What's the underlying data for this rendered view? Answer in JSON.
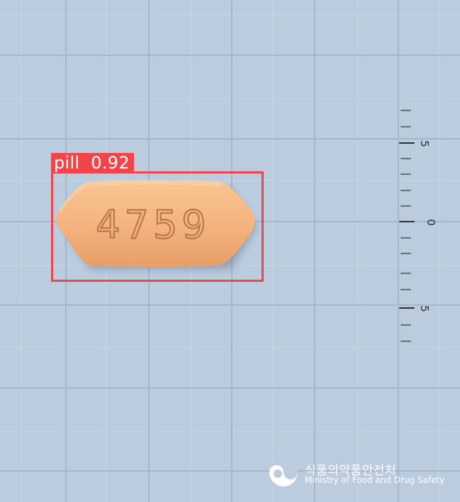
{
  "detection": {
    "label": "pill  0.92",
    "color": "#f2454a"
  },
  "pill": {
    "imprint": "4759",
    "color": "#f4b27e"
  },
  "ruler": {
    "labels": [
      "5",
      "0",
      "5"
    ]
  },
  "watermark": {
    "korean": "식품의약품안전처",
    "english": "Ministry of Food and Drug Safety",
    "logo_icon": "mfds-logo-icon"
  }
}
